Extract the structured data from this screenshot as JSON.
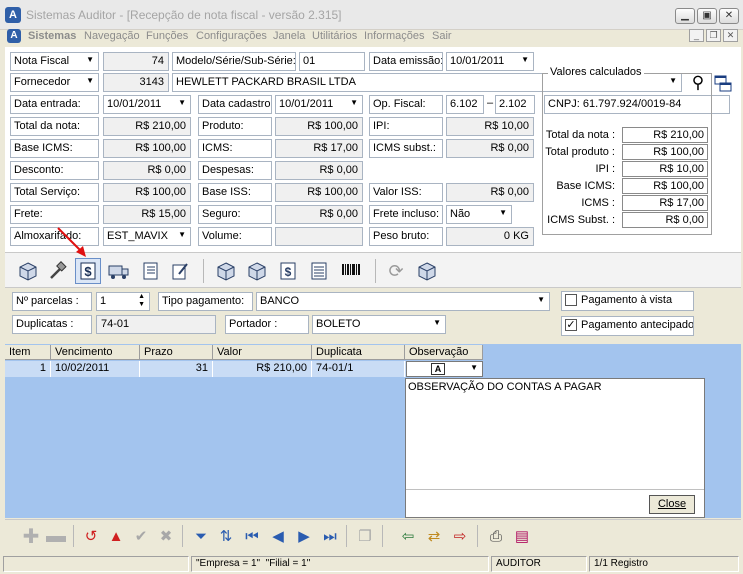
{
  "window": {
    "title": "Sistemas Auditor - [Recepção de nota fiscal - versão 2.315]"
  },
  "menu": {
    "items": [
      "Sistemas",
      "Navegação",
      "Funções",
      "Configurações",
      "Janela",
      "Utilitários",
      "Informações",
      "Sair"
    ]
  },
  "form": {
    "doc_type": "Nota Fiscal",
    "doc_number": "74",
    "modelo_label": "Modelo/Série/Sub-Série:",
    "modelo_value": "01",
    "data_emissao_label": "Data emissão:",
    "data_emissao_value": "10/01/2011",
    "fornecedor_label": "Fornecedor",
    "fornecedor_code": "3143",
    "fornecedor_name": "HEWLETT PACKARD BRASIL LTDA",
    "data_entrada_label": "Data entrada:",
    "data_entrada_value": "10/01/2011",
    "data_cadastro_label": "Data cadastro:",
    "data_cadastro_value": "10/01/2011",
    "op_fiscal_label": "Op. Fiscal:",
    "op_fiscal_1": "6.102",
    "op_fiscal_sep": "–",
    "op_fiscal_2": "2.102",
    "cnpj": "CNPJ: 61.797.924/0019-84",
    "total_nota_label": "Total da nota:",
    "total_nota_value": "R$ 210,00",
    "produto_label": "Produto:",
    "produto_value": "R$ 100,00",
    "ipi_label": "IPI:",
    "ipi_value": "R$ 10,00",
    "base_icms_label": "Base ICMS:",
    "base_icms_value": "R$ 100,00",
    "icms_label": "ICMS:",
    "icms_value": "R$ 17,00",
    "icms_subst_label": "ICMS subst.:",
    "icms_subst_value": "R$ 0,00",
    "desconto_label": "Desconto:",
    "desconto_value": "R$ 0,00",
    "despesas_label": "Despesas:",
    "despesas_value": "R$ 0,00",
    "total_servico_label": "Total Serviço:",
    "total_servico_value": "R$ 100,00",
    "base_iss_label": "Base ISS:",
    "base_iss_value": "R$ 100,00",
    "valor_iss_label": "Valor ISS:",
    "valor_iss_value": "R$ 0,00",
    "frete_label": "Frete:",
    "frete_value": "R$ 15,00",
    "seguro_label": "Seguro:",
    "seguro_value": "R$ 0,00",
    "frete_incluso_label": "Frete incluso:",
    "frete_incluso_value": "Não",
    "almoxarifado_label": "Almoxarifado:",
    "almoxarifado_value": "EST_MAVIX",
    "volume_label": "Volume:",
    "volume_value": "",
    "peso_bruto_label": "Peso bruto:",
    "peso_bruto_value": "0 KG"
  },
  "valores_calculados": {
    "title": "Valores calculados",
    "rows": [
      {
        "label": "Total da nota :",
        "value": "R$ 210,00"
      },
      {
        "label": "Total produto :",
        "value": "R$ 100,00"
      },
      {
        "label": "IPI :",
        "value": "R$ 10,00"
      },
      {
        "label": "Base ICMS:",
        "value": "R$ 100,00"
      },
      {
        "label": "ICMS :",
        "value": "R$ 17,00"
      },
      {
        "label": "ICMS Subst. :",
        "value": "R$ 0,00"
      }
    ]
  },
  "payment": {
    "parcelas_label": "Nº parcelas :",
    "parcelas_value": "1",
    "tipo_pagamento_label": "Tipo pagamento:",
    "tipo_pagamento_value": "BANCO",
    "pagamento_vista_label": "Pagamento à vista",
    "duplicatas_label": "Duplicatas :",
    "duplicatas_value": "74-01",
    "portador_label": "Portador :",
    "portador_value": "BOLETO",
    "pagamento_antecipado_label": "Pagamento antecipado"
  },
  "grid": {
    "columns": [
      "Item",
      "Vencimento",
      "Prazo",
      "Valor",
      "Duplicata",
      "Observação"
    ],
    "rows": [
      {
        "item": "1",
        "vencimento": "10/02/2011",
        "prazo": "31",
        "valor": "R$ 210,00",
        "duplicata": "74-01/1"
      }
    ],
    "obs_text": "OBSERVAÇÃO DO CONTAS A PAGAR",
    "close_label": "Close"
  },
  "status": {
    "empresa": "\"Empresa = 1\"",
    "filial": "\"Filial = 1\"",
    "user": "AUDITOR",
    "registro": "1/1 Registro"
  }
}
